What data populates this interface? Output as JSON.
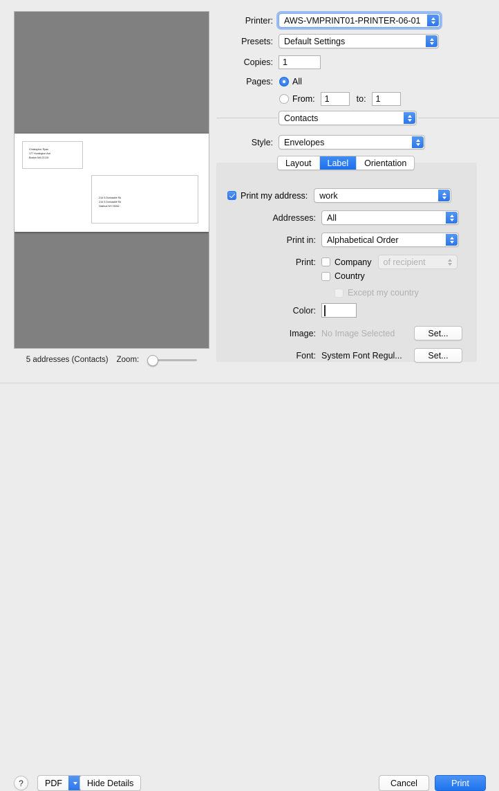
{
  "preview": {
    "return_address": {
      "lines": [
        "Christopher Ryan",
        "177 Huntington Ave",
        "Boston MA 02115"
      ]
    },
    "recipient_address": {
      "lines": [
        "216 S Dunstable Rd",
        "216 S Dunstable Rd",
        "Nashua NH 03062"
      ]
    },
    "status": "5 addresses (Contacts)",
    "zoom_label": "Zoom:",
    "zoom_value": 0
  },
  "settings": {
    "printer_label": "Printer:",
    "printer_value": "AWS-VMPRINT01-PRINTER-06-01",
    "presets_label": "Presets:",
    "presets_value": "Default Settings",
    "copies_label": "Copies:",
    "copies_value": "1",
    "pages_label": "Pages:",
    "pages_all_label": "All",
    "pages_from_label": "From:",
    "pages_from_value": "1",
    "pages_to_label": "to:",
    "pages_to_value": "1",
    "module_value": "Contacts",
    "style_label": "Style:",
    "style_value": "Envelopes"
  },
  "tabs": [
    {
      "label": "Layout",
      "active": false
    },
    {
      "label": "Label",
      "active": true
    },
    {
      "label": "Orientation",
      "active": false
    }
  ],
  "label_tab": {
    "print_my_address_label": "Print my address:",
    "print_my_address_checked": true,
    "print_my_address_value": "work",
    "addresses_label": "Addresses:",
    "addresses_value": "All",
    "print_in_label": "Print in:",
    "print_in_value": "Alphabetical Order",
    "print_label": "Print:",
    "company_label": "Company",
    "company_checked": false,
    "of_recipient_value": "of recipient",
    "country_label": "Country",
    "country_checked": false,
    "except_my_country_label": "Except my country",
    "except_my_country_checked": false,
    "color_label": "Color:",
    "color_value": "#000000",
    "image_label": "Image:",
    "image_value": "No Image Selected",
    "image_set_button": "Set...",
    "font_label": "Font:",
    "font_value": "System Font Regul...",
    "font_set_button": "Set..."
  },
  "bottom_bar": {
    "help_label": "?",
    "pdf_label": "PDF",
    "hide_details_label": "Hide Details",
    "cancel_label": "Cancel",
    "print_label": "Print"
  },
  "colors": {
    "accent": "#2d77ec",
    "window_bg": "#ececec",
    "preview_bg": "#808080",
    "panel_bg": "#e3e3e3"
  }
}
